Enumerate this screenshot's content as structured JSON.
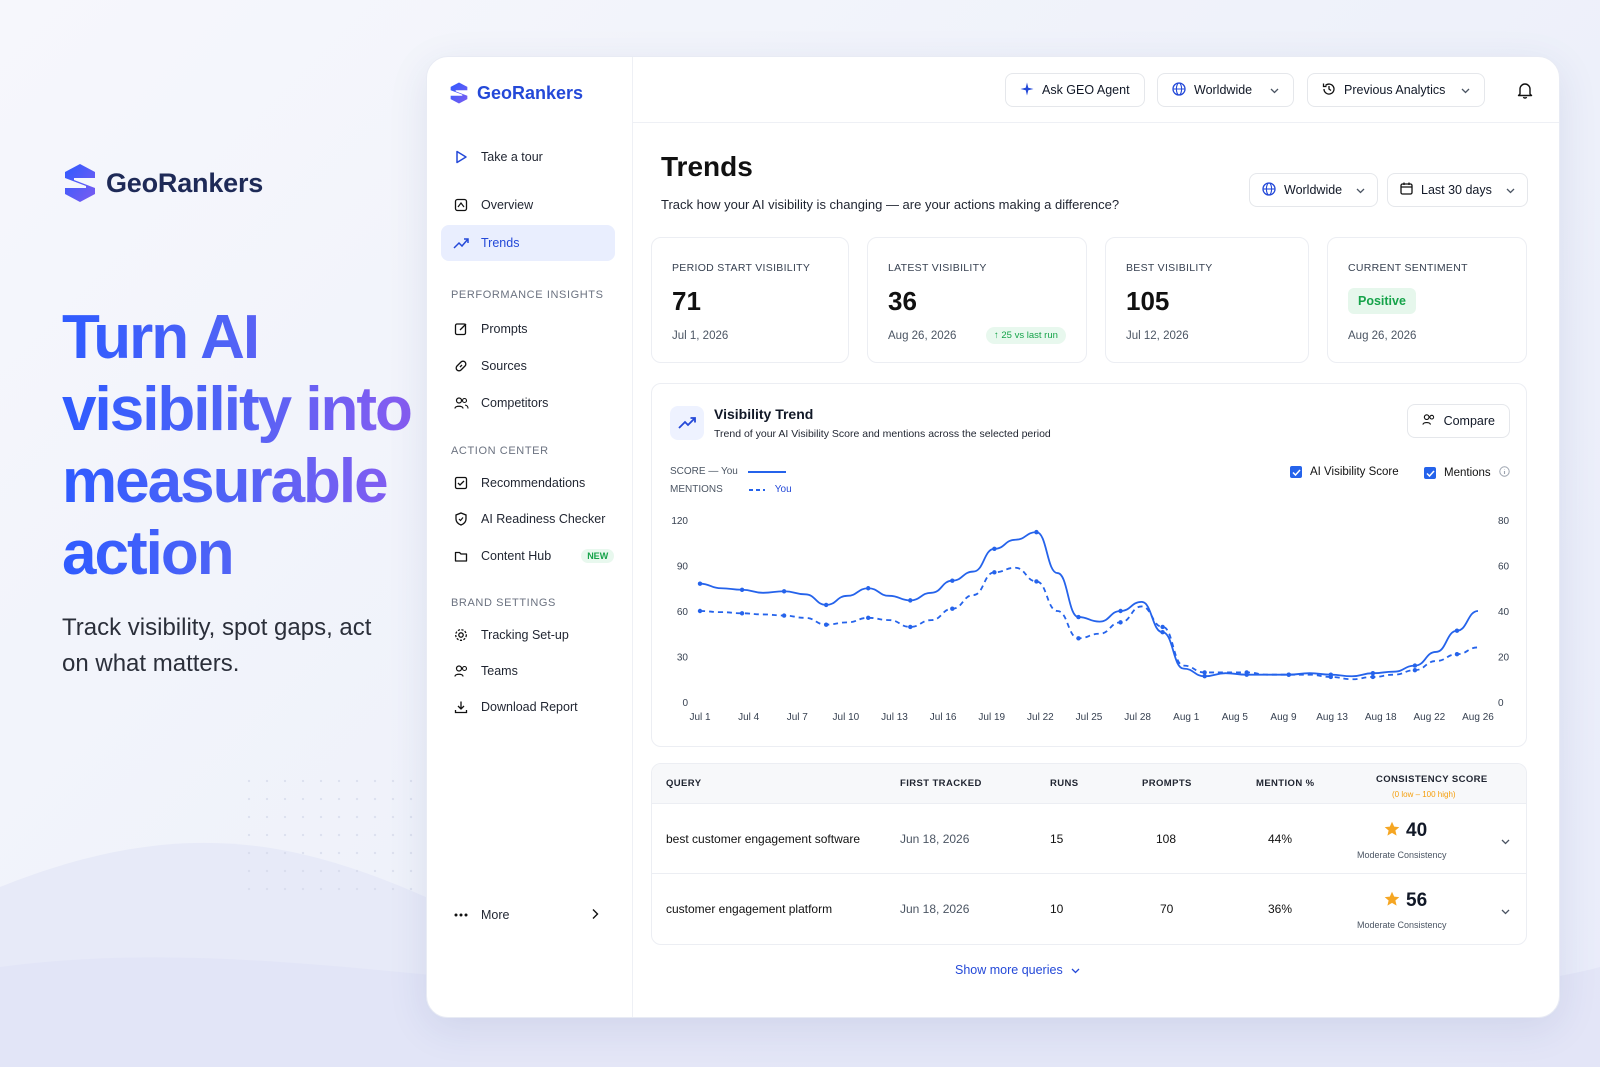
{
  "hero": {
    "brand": "GeoRankers",
    "headline": "Turn AI visibility into measurable action",
    "subtext": "Track visibility, spot gaps, act on what matters."
  },
  "app": {
    "brand": "GeoRankers",
    "topbar": {
      "ask_agent": "Ask GEO Agent",
      "region": "Worldwide",
      "previous": "Previous Analytics"
    },
    "sidebar": {
      "tour": "Take a tour",
      "overview": "Overview",
      "trends": "Trends",
      "sections": {
        "performance": "PERFORMANCE INSIGHTS",
        "action": "ACTION CENTER",
        "brand": "BRAND SETTINGS"
      },
      "prompts": "Prompts",
      "sources": "Sources",
      "competitors": "Competitors",
      "recommendations": "Recommendations",
      "readiness": "AI Readiness Checker",
      "content_hub": "Content Hub",
      "new_badge": "NEW",
      "tracking": "Tracking Set-up",
      "teams": "Teams",
      "download": "Download Report",
      "more": "More"
    },
    "page": {
      "title": "Trends",
      "subtitle": "Track how your AI visibility is changing — are your actions making a difference?",
      "filter_region": "Worldwide",
      "filter_period": "Last 30 days"
    },
    "kpis": {
      "start": {
        "label": "PERIOD START VISIBILITY",
        "value": "71",
        "date": "Jul 1, 2026"
      },
      "latest": {
        "label": "LATEST VISIBILITY",
        "value": "36",
        "date": "Aug 26, 2026",
        "delta": "↑ 25 vs last run"
      },
      "best": {
        "label": "BEST VISIBILITY",
        "value": "105",
        "date": "Jul 12, 2026"
      },
      "sentiment": {
        "label": "CURRENT SENTIMENT",
        "value": "Positive",
        "date": "Aug 26, 2026"
      }
    },
    "trend_card": {
      "title": "Visibility Trend",
      "subtitle": "Trend of your AI Visibility Score and mentions across the selected period",
      "compare": "Compare",
      "legend_score": "SCORE — You",
      "legend_mentions": "MENTIONS",
      "legend_mentions_you": "You",
      "check_score": "AI Visibility Score",
      "check_mentions": "Mentions"
    },
    "table": {
      "headers": {
        "query": "QUERY",
        "first": "FIRST TRACKED",
        "runs": "RUNS",
        "prompts": "PROMPTS",
        "mention": "MENTION %",
        "consistency": "CONSISTENCY SCORE",
        "consistency_hint": "(0 low – 100 high)"
      },
      "rows": [
        {
          "query": "best customer engagement software",
          "first": "Jun 18, 2026",
          "runs": "15",
          "prompts": "108",
          "mention": "44%",
          "score": "40",
          "score_label": "Moderate Consistency"
        },
        {
          "query": "customer engagement platform",
          "first": "Jun 18, 2026",
          "runs": "10",
          "prompts": "70",
          "mention": "36%",
          "score": "56",
          "score_label": "Moderate Consistency"
        }
      ],
      "show_more": "Show more queries"
    }
  },
  "colors": {
    "accent": "#2449d8",
    "line": "#2563eb",
    "positive": "#16a34a",
    "star": "#f5a623"
  },
  "chart_data": {
    "type": "line",
    "title": "Visibility Trend",
    "x": [
      "Jul 1",
      "Jul 4",
      "Jul 7",
      "Jul 10",
      "Jul 13",
      "Jul 16",
      "Jul 19",
      "Jul 22",
      "Jul 25",
      "Jul 28",
      "Aug 1",
      "Aug 5",
      "Aug 9",
      "Aug 13",
      "Aug 18",
      "Aug 22",
      "Aug 26"
    ],
    "x_ticks": [
      "Jul 1",
      "Jul 4",
      "Jul 7",
      "Jul 10",
      "Jul 13",
      "Jul 16",
      "Jul 19",
      "Jul 22",
      "Jul 25",
      "Jul 28",
      "Aug 1",
      "Aug 5",
      "Aug 9",
      "Aug 13",
      "Aug 18",
      "Aug 22",
      "Aug 26"
    ],
    "y_left_ticks": [
      0,
      30,
      60,
      90,
      120
    ],
    "y_right_ticks": [
      0,
      20,
      40,
      60,
      80
    ],
    "ylim_left": [
      0,
      120
    ],
    "ylim_right": [
      0,
      80
    ],
    "series": [
      {
        "name": "SCORE — You",
        "axis": "left",
        "style": "solid",
        "points": [
          [
            0,
            78
          ],
          [
            1,
            75
          ],
          [
            2,
            74
          ],
          [
            3,
            72
          ],
          [
            4,
            73
          ],
          [
            5,
            71
          ],
          [
            6,
            64
          ],
          [
            7,
            70
          ],
          [
            8,
            75
          ],
          [
            9,
            70
          ],
          [
            10,
            67
          ],
          [
            11,
            72
          ],
          [
            12,
            80
          ],
          [
            13,
            86
          ],
          [
            14,
            101
          ],
          [
            15,
            107
          ],
          [
            16,
            112
          ],
          [
            17,
            85
          ],
          [
            18,
            56
          ],
          [
            19,
            53
          ],
          [
            20,
            60
          ],
          [
            21,
            66
          ],
          [
            22,
            46
          ],
          [
            23,
            22
          ],
          [
            24,
            17
          ],
          [
            25,
            19
          ],
          [
            26,
            18
          ],
          [
            27,
            18
          ],
          [
            28,
            18
          ],
          [
            29,
            19
          ],
          [
            30,
            18
          ],
          [
            31,
            17
          ],
          [
            32,
            19
          ],
          [
            33,
            20
          ],
          [
            34,
            24
          ],
          [
            35,
            33
          ],
          [
            36,
            47
          ],
          [
            37,
            60
          ]
        ]
      },
      {
        "name": "MENTIONS — You",
        "axis": "right",
        "style": "dashed",
        "points": [
          [
            0,
            40
          ],
          [
            1,
            39.5
          ],
          [
            2,
            39
          ],
          [
            3,
            38.5
          ],
          [
            4,
            38
          ],
          [
            5,
            37
          ],
          [
            6,
            34
          ],
          [
            7,
            35
          ],
          [
            8,
            37
          ],
          [
            9,
            36
          ],
          [
            10,
            33
          ],
          [
            11,
            36
          ],
          [
            12,
            41
          ],
          [
            13,
            47
          ],
          [
            14,
            57
          ],
          [
            15,
            59
          ],
          [
            16,
            53
          ],
          [
            17,
            40
          ],
          [
            18,
            28
          ],
          [
            19,
            30
          ],
          [
            20,
            35
          ],
          [
            21,
            42
          ],
          [
            22,
            33
          ],
          [
            23,
            16
          ],
          [
            24,
            13
          ],
          [
            25,
            13
          ],
          [
            26,
            13
          ],
          [
            27,
            12
          ],
          [
            28,
            12
          ],
          [
            29,
            12
          ],
          [
            30,
            11
          ],
          [
            31,
            10
          ],
          [
            32,
            11
          ],
          [
            33,
            12
          ],
          [
            34,
            14
          ],
          [
            35,
            18
          ],
          [
            36,
            21
          ],
          [
            37,
            24
          ]
        ]
      }
    ],
    "grid": false,
    "legend": "top-left"
  }
}
